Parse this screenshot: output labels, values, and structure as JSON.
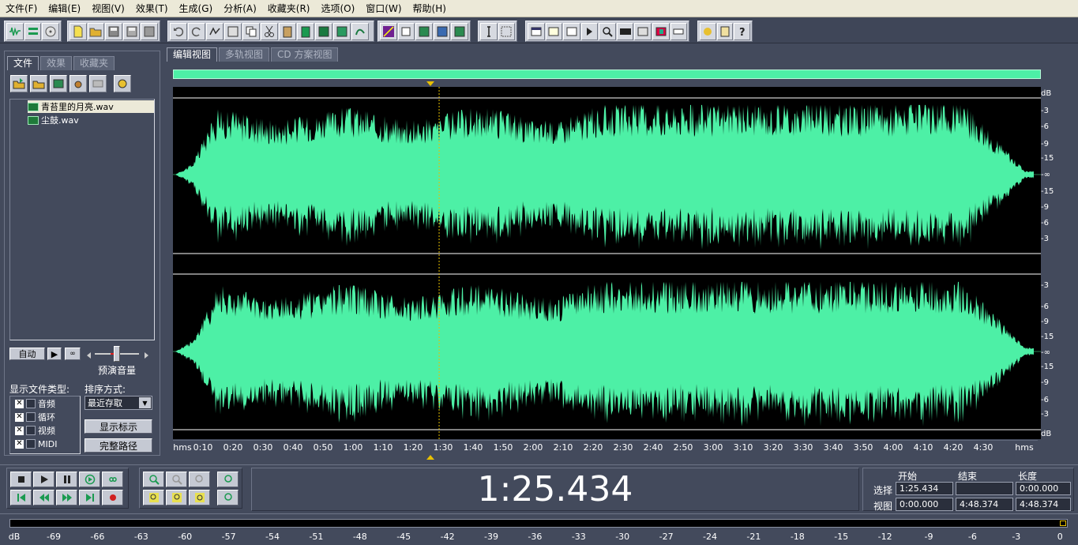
{
  "menu": [
    "文件(F)",
    "编辑(E)",
    "视图(V)",
    "效果(T)",
    "生成(G)",
    "分析(A)",
    "收藏夹(R)",
    "选项(O)",
    "窗口(W)",
    "帮助(H)"
  ],
  "left_tabs": [
    "文件",
    "效果",
    "收藏夹"
  ],
  "files": [
    "青苔里的月亮.wav",
    "尘鼓.wav"
  ],
  "preview": {
    "auto_label": "自动",
    "volume_label": "预演音量"
  },
  "show_types_label": "显示文件类型:",
  "sort_label": "排序方式:",
  "file_types": [
    "音频",
    "循环",
    "视频",
    "MIDI"
  ],
  "sort_value": "最近存取",
  "show_hint_button": "显示标示",
  "full_path_button": "完整路径",
  "view_tabs": [
    "编辑视图",
    "多轨视图",
    "CD 方案视图"
  ],
  "timeline_ticks": [
    "hms",
    "0:10",
    "0:20",
    "0:30",
    "0:40",
    "0:50",
    "1:00",
    "1:10",
    "1:20",
    "1:30",
    "1:40",
    "1:50",
    "2:00",
    "2:10",
    "2:20",
    "2:30",
    "2:40",
    "2:50",
    "3:00",
    "3:10",
    "3:20",
    "3:30",
    "3:40",
    "3:50",
    "4:00",
    "4:10",
    "4:20",
    "4:30",
    "hms"
  ],
  "db_scale_top": [
    "dB",
    "-3",
    "-6",
    "-9",
    "-15",
    "-∞",
    "-15",
    "-9",
    "-6",
    "-3"
  ],
  "db_scale_bottom": [
    "-3",
    "-6",
    "-9",
    "-15",
    "-∞",
    "-15",
    "-9",
    "-6",
    "-3",
    "dB"
  ],
  "current_time": "1:25.434",
  "time_headers": {
    "start": "开始",
    "end": "结束",
    "length": "长度"
  },
  "selection": {
    "label": "选择",
    "start": "1:25.434",
    "end": "",
    "length": "0:00.000"
  },
  "view": {
    "label": "视图",
    "start": "0:00.000",
    "end": "4:48.374",
    "length": "4:48.374"
  },
  "meter_ticks": [
    "dB",
    "-69",
    "-66",
    "-63",
    "-60",
    "-57",
    "-54",
    "-51",
    "-48",
    "-45",
    "-42",
    "-39",
    "-36",
    "-33",
    "-30",
    "-27",
    "-24",
    "-21",
    "-18",
    "-15",
    "-12",
    "-9",
    "-6",
    "-3",
    "0"
  ],
  "colors": {
    "waveform": "#4df0a6",
    "background": "#000000",
    "panel": "#434a5c",
    "cursor": "#e8c000"
  },
  "waveform": {
    "duration_seconds": 288.374,
    "cursor_seconds": 85.434
  }
}
